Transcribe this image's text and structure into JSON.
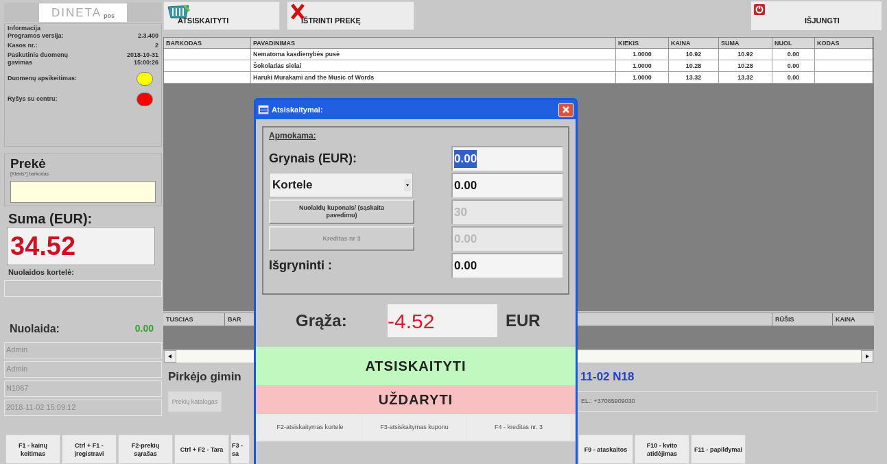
{
  "toolbar": {
    "logo": "DINETA",
    "logo_suffix": "pos",
    "buttons": [
      {
        "label": "ATSISKAITYTI",
        "kind": "basket"
      },
      {
        "label": "IŠTRINTI PREKĘ",
        "kind": "delete"
      }
    ],
    "exit": {
      "label": "IŠJUNGTI"
    }
  },
  "info": {
    "title": "Informacija",
    "rows": [
      {
        "label": "Programos versija:",
        "value": "2.3.400"
      },
      {
        "label": "Kasos nr.:",
        "value": "2"
      },
      {
        "label": "Paskutinis duomenų gavimas",
        "value": "2018-10-31 15:00:26"
      }
    ],
    "indicators": [
      {
        "label": "Duomenų apsikeitimas:",
        "color": "#ffff00"
      },
      {
        "label": "Ryšys su centru:",
        "color": "#ff0000"
      }
    ]
  },
  "item": {
    "title": "Prekė",
    "hint": "[Kiekis*] barkodas"
  },
  "total": {
    "label": "Suma (EUR):",
    "value": "34.52"
  },
  "discount_card": {
    "label": "Nuolaidos kortelė:"
  },
  "discount": {
    "label": "Nuolaida:",
    "value": "0.00"
  },
  "session_fields": [
    "Admin",
    "Admin",
    "N1067",
    "2018-11-02 15:09:12"
  ],
  "items_table": {
    "columns": [
      "BARKODAS",
      "PAVADINIMAS",
      "KIEKIS",
      "KAINA",
      "SUMA",
      "NUOL",
      "KODAS"
    ],
    "rows": [
      {
        "name": "Nematoma kasdienybės pusė",
        "qty": "1.0000",
        "price": "10.92",
        "sum": "10.92",
        "discount": "0.00"
      },
      {
        "name": "Šokoladas sielai",
        "qty": "1.0000",
        "price": "10.28",
        "sum": "10.28",
        "discount": "0.00"
      },
      {
        "name": "Haruki Murakami and the Music of Words",
        "qty": "1.0000",
        "price": "13.32",
        "sum": "13.32",
        "discount": "0.00"
      }
    ]
  },
  "lower_table": {
    "left_columns": [
      "TUSCIAS",
      "BAR"
    ],
    "right_columns": [
      "RŪŠIS",
      "KAINA"
    ]
  },
  "customer": {
    "heading": "Pirkėjo gimin",
    "heading_right": "11-02 N18",
    "phone": "EL.: +37065909030",
    "catalog_button": {
      "label": "Prekių katalogas",
      "disabled": true
    }
  },
  "function_keys_left": [
    "F1 - kainų keitimas",
    "Ctrl + F1 - įregistravi",
    "F2-prekių sąrašas",
    "Ctrl + F2 - Tara",
    "F3 - sa"
  ],
  "function_keys_right": [
    "F9 - ataskaitos",
    "F10 - kvito atidėjimas",
    "F11 - papildymai"
  ],
  "dialog": {
    "title": "Atsiskaitymai:",
    "group_label": "Apmokama:",
    "rows": [
      {
        "kind": "label",
        "label": "Grynais (EUR):",
        "value": "0.00",
        "highlighted": true,
        "field_disabled": false
      },
      {
        "kind": "dropdown",
        "label": "Kortele",
        "value": "0.00",
        "highlighted": false,
        "field_disabled": false
      },
      {
        "kind": "button",
        "label": "Nuolaidų kuponais/ (sąskaita pavedimu)",
        "disabled": false,
        "value": "30",
        "highlighted": false,
        "field_disabled": true
      },
      {
        "kind": "button",
        "label": "Kreditas nr 3",
        "disabled": true,
        "value": "0.00",
        "highlighted": false,
        "field_disabled": true
      },
      {
        "kind": "label",
        "label": "Išgryninti :",
        "value": "0.00",
        "highlighted": false,
        "field_disabled": false
      }
    ],
    "change": {
      "label": "Grąža:",
      "value": "-4.52",
      "currency": "EUR"
    },
    "buttons": [
      {
        "label": "ATSISKAITYTI",
        "kind": "confirm"
      },
      {
        "label": "UŽDARYTI",
        "kind": "close"
      }
    ],
    "shortcuts": [
      "F2-atsiskaitymas kortele",
      "F3-atsiskaitymas kuponu",
      "F4 - kreditas nr. 3"
    ]
  }
}
